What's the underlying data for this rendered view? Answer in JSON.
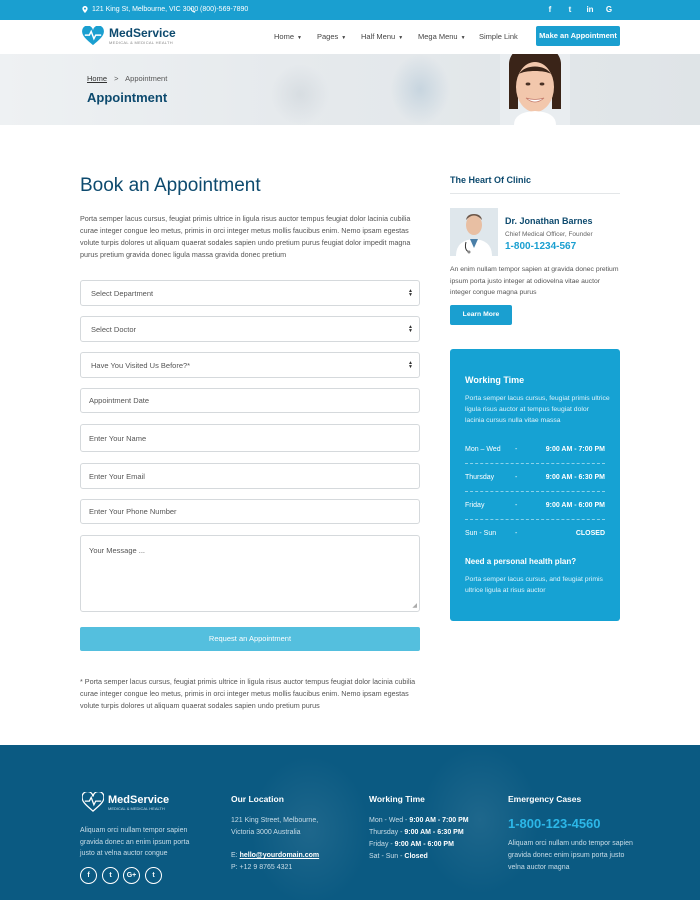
{
  "colors": {
    "primary": "#1a9fd0",
    "dark": "#0d4a6e",
    "footer": "#0b5a82",
    "submit": "#54bfde"
  },
  "topbar": {
    "address": "121 King St, Melbourne, VIC 3000",
    "phone": "(800)-569-7890",
    "social": [
      "f",
      "t",
      "in",
      "G"
    ]
  },
  "header": {
    "logo_name": "MedService",
    "logo_tag": "MEDICAL & MEDICAL HEALTH",
    "nav": [
      "Home",
      "Pages",
      "Half Menu",
      "Mega Menu",
      "Simple Link"
    ],
    "cta": "Make an Appointment"
  },
  "banner": {
    "crumb_home": "Home",
    "crumb_sep": ">",
    "crumb_current": "Appointment",
    "title": "Appointment"
  },
  "form": {
    "heading": "Book an Appointment",
    "intro": "Porta semper lacus cursus, feugiat primis ultrice in ligula risus auctor tempus feugiat dolor lacinia cubilia curae integer congue leo metus, primis in orci integer metus mollis faucibus enim. Nemo ipsam egestas volute turpis dolores ut aliquam quaerat sodales sapien undo pretium purus feugiat dolor impedit magna purus pretium gravida donec ligula massa gravida donec pretium",
    "department": "Select Department",
    "doctor": "Select Doctor",
    "visited": "Have You Visited Us Before?*",
    "date": "Appointment Date",
    "name": "Enter Your Name",
    "email": "Enter Your Email",
    "phone": "Enter Your Phone Number",
    "message": "Your Message ...",
    "submit": "Request an Appointment",
    "note": "* Porta semper lacus cursus, feugiat primis ultrice in ligula risus auctor tempus feugiat dolor lacinia cubilia curae integer congue leo metus, primis in orci integer metus mollis faucibus enim. Nemo ipsam egestas volute turpis dolores ut aliquam quaerat sodales sapien undo pretium purus"
  },
  "sidebar": {
    "heart_title": "The Heart Of Clinic",
    "doctor_name": "Dr. Jonathan Barnes",
    "doctor_role": "Chief Medical Officer, Founder",
    "doctor_phone": "1-800-1234-567",
    "text": "An enim nullam tempor sapien at gravida donec pretium ipsum porta justo integer at odiovelna vitae auctor integer congue magna purus",
    "learn_more": "Learn More",
    "working": {
      "title": "Working Time",
      "text": "Porta semper lacus cursus, feugiat primis ultrice ligula risus auctor at tempus feugiat dolor lacinia cursus nulla vitae massa",
      "rows": [
        {
          "day": "Mon – Wed",
          "dash": "-",
          "time": "9:00 AM - 7:00 PM"
        },
        {
          "day": "Thursday",
          "dash": "-",
          "time": "9:00 AM - 6:30 PM"
        },
        {
          "day": "Friday",
          "dash": "-",
          "time": "9:00 AM - 6:00 PM"
        },
        {
          "day": "Sun - Sun",
          "dash": "-",
          "time": "CLOSED"
        }
      ],
      "question": "Need a personal health plan?",
      "question_text": "Porta semper lacus cursus, and feugiat primis ultrice ligula at risus auctor"
    }
  },
  "footer": {
    "logo_name": "MedService",
    "logo_tag": "MEDICAL & MEDICAL HEALTH",
    "about": "Aliquam orci nullam tempor sapien gravida donec an enim ipsum porta justo at velna auctor congue",
    "social": [
      "f",
      "t",
      "G+",
      "t"
    ],
    "location_title": "Our Location",
    "location_line1": "121 King Street, Melbourne,",
    "location_line2": "Victoria 3000 Australia",
    "email_label": "E:",
    "email": "hello@yourdomain.com",
    "phone": "P: +12 9 8765 4321",
    "hours_title": "Working Time",
    "hours": [
      {
        "day": "Mon - Wed - ",
        "time": "9:00 AM - 7:00 PM"
      },
      {
        "day": "Thursday - ",
        "time": "9:00 AM - 6:30 PM"
      },
      {
        "day": "Friday - ",
        "time": "9:00 AM - 6:00 PM"
      },
      {
        "day": "Sat - Sun - ",
        "time": "Closed"
      }
    ],
    "emergency_title": "Emergency Cases",
    "emergency_phone": "1-800-123-4560",
    "emergency_text": "Aliquam orci nullam undo tempor sapien gravida donec enim ipsum porta justo velna auctor magna"
  }
}
